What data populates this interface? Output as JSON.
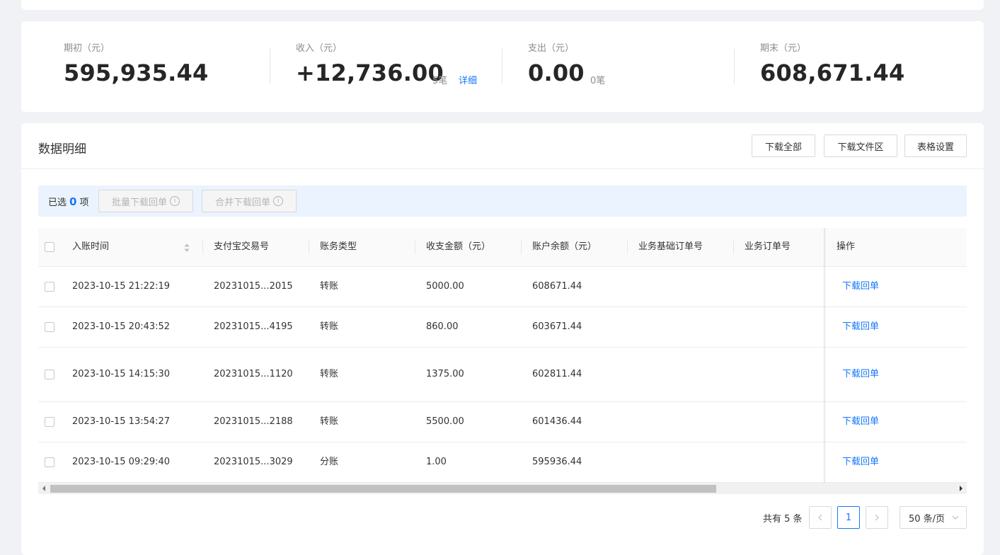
{
  "summary": {
    "opening": {
      "label": "期初（元）",
      "value": "595,935.44"
    },
    "income": {
      "label": "收入（元）",
      "value": "+12,736.00",
      "count": "5笔",
      "link": "详细"
    },
    "expense": {
      "label": "支出（元）",
      "value": "0.00",
      "count": "0笔"
    },
    "closing": {
      "label": "期末（元）",
      "value": "608,671.44"
    }
  },
  "detail": {
    "title": "数据明细",
    "buttons": {
      "download_all": "下载全部",
      "download_files": "下载文件区",
      "table_settings": "表格设置"
    },
    "selection": {
      "prefix": "已选",
      "count": "0",
      "suffix": "项",
      "batch_download": "批量下载回单",
      "merge_download": "合并下载回单"
    },
    "columns": [
      "入账时间",
      "支付宝交易号",
      "账务类型",
      "收支金额（元）",
      "账户余额（元）",
      "业务基础订单号",
      "业务订单号",
      "操作"
    ],
    "rows": [
      {
        "time": "2023-10-15 21:22:19",
        "trade_no": "20231015...2015",
        "type": "转账",
        "amount": "5000.00",
        "balance": "608671.44",
        "action": "下载回单"
      },
      {
        "time": "2023-10-15 20:43:52",
        "trade_no": "20231015...4195",
        "type": "转账",
        "amount": "860.00",
        "balance": "603671.44",
        "action": "下载回单"
      },
      {
        "time": "2023-10-15 14:15:30",
        "trade_no": "20231015...1120",
        "type": "转账",
        "amount": "1375.00",
        "balance": "602811.44",
        "action": "下载回单"
      },
      {
        "time": "2023-10-15 13:54:27",
        "trade_no": "20231015...2188",
        "type": "转账",
        "amount": "5500.00",
        "balance": "601436.44",
        "action": "下载回单"
      },
      {
        "time": "2023-10-15 09:29:40",
        "trade_no": "20231015...3029",
        "type": "分账",
        "amount": "1.00",
        "balance": "595936.44",
        "action": "下载回单"
      }
    ]
  },
  "pagination": {
    "total": "共有 5 条",
    "current": "1",
    "page_size": "50 条/页"
  },
  "colors": {
    "accent": "#1677ff",
    "selection_bg": "#ebf3fe"
  }
}
